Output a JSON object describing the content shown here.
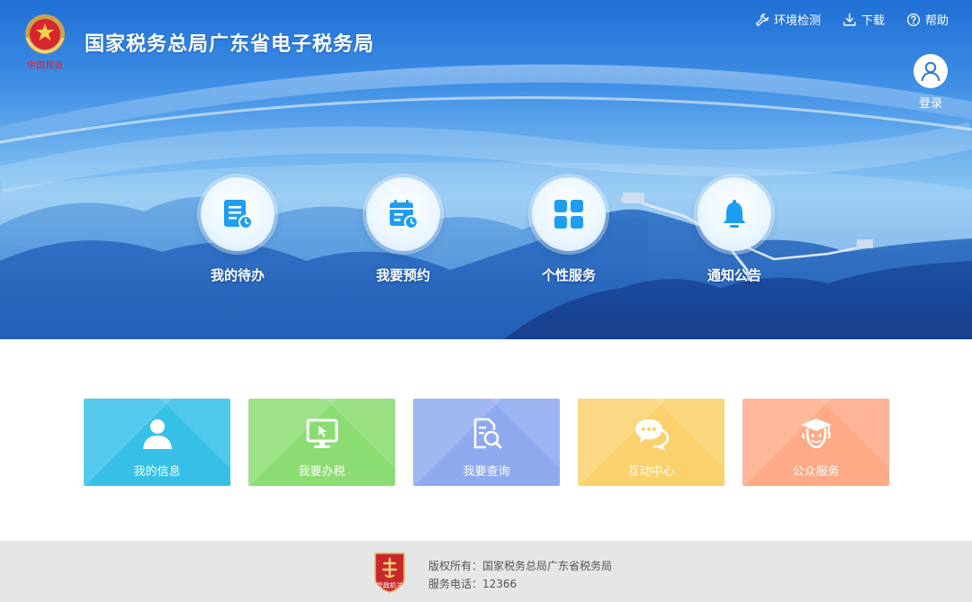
{
  "header": {
    "title": "国家税务总局广东省电子税务局",
    "logo": {
      "icon": "tax-emblem-icon",
      "caption": "中国税务"
    },
    "links": [
      {
        "label": "环境检测",
        "icon": "wrench-icon"
      },
      {
        "label": "下载",
        "icon": "download-icon"
      },
      {
        "label": "帮助",
        "icon": "help-icon"
      }
    ],
    "login": {
      "label": "登录",
      "icon": "user-avatar-icon"
    }
  },
  "features": [
    {
      "label": "我的待办",
      "icon": "todo-list-icon"
    },
    {
      "label": "我要预约",
      "icon": "calendar-clock-icon"
    },
    {
      "label": "个性服务",
      "icon": "grid-apps-icon"
    },
    {
      "label": "通知公告",
      "icon": "bell-icon"
    }
  ],
  "tiles": [
    {
      "label": "我的信息",
      "icon": "person-icon",
      "color": "#36c0e8"
    },
    {
      "label": "我要办税",
      "icon": "monitor-cursor-icon",
      "color": "#8bdc72"
    },
    {
      "label": "我要查询",
      "icon": "document-search-icon",
      "color": "#8fa9ef"
    },
    {
      "label": "互动中心",
      "icon": "chat-bubble-icon",
      "color": "#fad16c"
    },
    {
      "label": "公众服务",
      "icon": "graduate-face-icon",
      "color": "#feaa87"
    }
  ],
  "footer": {
    "badge": {
      "icon": "party-government-badge-icon",
      "caption": "党政机关"
    },
    "copyright": "版权所有：国家税务总局广东省税务局",
    "phone": "服务电话：12366"
  }
}
